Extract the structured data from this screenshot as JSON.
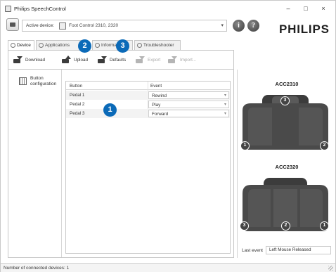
{
  "window": {
    "title": "Philips SpeechControl",
    "controls": {
      "minimize": "–",
      "maximize": "□",
      "close": "×"
    }
  },
  "device_bar": {
    "active_label": "Active device:",
    "active_value": "Foot Control 2310, 2320",
    "dropdown_glyph": "▾",
    "info_icon_glyph": "i",
    "help_icon_glyph": "?",
    "logo": "PHILIPS"
  },
  "tabs": [
    {
      "label": "Device",
      "active": true
    },
    {
      "label": "Applications",
      "active": false
    },
    {
      "label": "Information",
      "active": false
    },
    {
      "label": "Troubleshooter",
      "active": false
    }
  ],
  "toolbar": {
    "download": "Download",
    "upload": "Upload",
    "defaults": "Defaults",
    "export": "Export",
    "import": "Import..."
  },
  "side_nav": {
    "label": "Button configuration"
  },
  "grid": {
    "columns": [
      "Button",
      "Event"
    ],
    "rows": [
      {
        "button": "Pedal 1",
        "event": "Rewind"
      },
      {
        "button": "Pedal 2",
        "event": "Play"
      },
      {
        "button": "Pedal 3",
        "event": "Forward"
      }
    ]
  },
  "right_pane": {
    "device1": {
      "name": "ACC2310",
      "badges": [
        "3",
        "1",
        "2"
      ]
    },
    "device2": {
      "name": "ACC2320",
      "badges": [
        "3",
        "2",
        "1"
      ]
    },
    "last_event_label": "Last event",
    "last_event_value": "Left Mouse Released"
  },
  "status_bar": {
    "text": "Number of connected devices: 1"
  },
  "callouts": [
    "1",
    "2",
    "3"
  ],
  "colors": {
    "callout": "#0b6ab8",
    "pedal": "#4a4a4a"
  }
}
